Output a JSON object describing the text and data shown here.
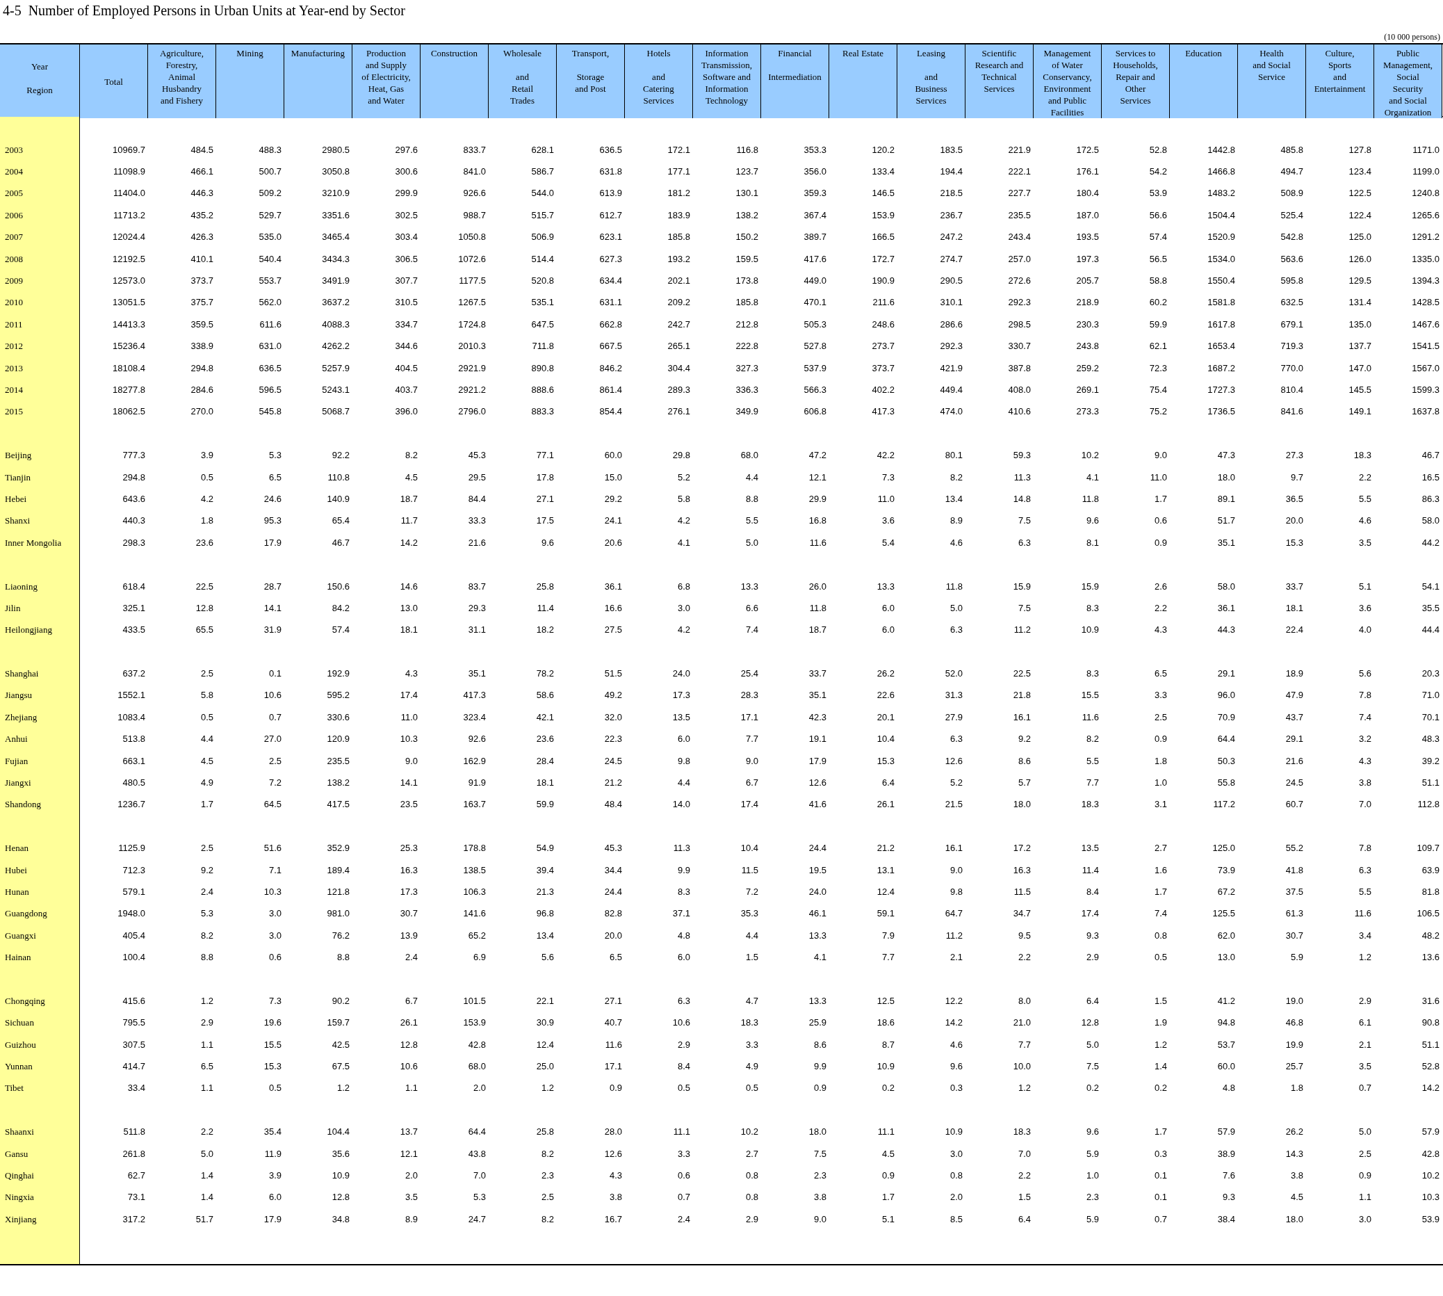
{
  "title": "4-5  Number of Employed Persons in Urban Units at Year-end by Sector",
  "unit": "(10 000 persons)",
  "table": {
    "corner": {
      "year_label": "Year",
      "region_label": "Region"
    },
    "columns": [
      "Total",
      "Agriculture,\nForestry,\nAnimal\nHusbandry\nand Fishery",
      "Mining",
      "Manufacturing",
      "Production\nand Supply\nof Electricity,\nHeat, Gas\nand Water",
      "Construction",
      "Wholesale\n\nand\nRetail\nTrades",
      "Transport,\n\nStorage\nand Post",
      "Hotels\n\nand\nCatering\nServices",
      "Information\nTransmission,\nSoftware and\nInformation\nTechnology",
      "Financial\n\nIntermediation",
      "Real Estate",
      "Leasing\n\nand\nBusiness\nServices",
      "Scientific\nResearch and\nTechnical\nServices",
      "Management\nof Water\nConservancy,\nEnvironment\nand Public\nFacilities",
      "Services to\nHouseholds,\nRepair and\nOther\nServices",
      "Education",
      "Health\nand Social\nService",
      "Culture,\nSports\nand\nEntertainment",
      "Public\nManagement,\nSocial\nSecurity\nand Social\nOrganization"
    ],
    "groups": [
      {
        "rows": [
          {
            "label": "2003",
            "values": [
              "10969.7",
              "484.5",
              "488.3",
              "2980.5",
              "297.6",
              "833.7",
              "628.1",
              "636.5",
              "172.1",
              "116.8",
              "353.3",
              "120.2",
              "183.5",
              "221.9",
              "172.5",
              "52.8",
              "1442.8",
              "485.8",
              "127.8",
              "1171.0"
            ]
          },
          {
            "label": "2004",
            "values": [
              "11098.9",
              "466.1",
              "500.7",
              "3050.8",
              "300.6",
              "841.0",
              "586.7",
              "631.8",
              "177.1",
              "123.7",
              "356.0",
              "133.4",
              "194.4",
              "222.1",
              "176.1",
              "54.2",
              "1466.8",
              "494.7",
              "123.4",
              "1199.0"
            ]
          },
          {
            "label": "2005",
            "values": [
              "11404.0",
              "446.3",
              "509.2",
              "3210.9",
              "299.9",
              "926.6",
              "544.0",
              "613.9",
              "181.2",
              "130.1",
              "359.3",
              "146.5",
              "218.5",
              "227.7",
              "180.4",
              "53.9",
              "1483.2",
              "508.9",
              "122.5",
              "1240.8"
            ]
          },
          {
            "label": "2006",
            "values": [
              "11713.2",
              "435.2",
              "529.7",
              "3351.6",
              "302.5",
              "988.7",
              "515.7",
              "612.7",
              "183.9",
              "138.2",
              "367.4",
              "153.9",
              "236.7",
              "235.5",
              "187.0",
              "56.6",
              "1504.4",
              "525.4",
              "122.4",
              "1265.6"
            ]
          },
          {
            "label": "2007",
            "values": [
              "12024.4",
              "426.3",
              "535.0",
              "3465.4",
              "303.4",
              "1050.8",
              "506.9",
              "623.1",
              "185.8",
              "150.2",
              "389.7",
              "166.5",
              "247.2",
              "243.4",
              "193.5",
              "57.4",
              "1520.9",
              "542.8",
              "125.0",
              "1291.2"
            ]
          },
          {
            "label": "2008",
            "values": [
              "12192.5",
              "410.1",
              "540.4",
              "3434.3",
              "306.5",
              "1072.6",
              "514.4",
              "627.3",
              "193.2",
              "159.5",
              "417.6",
              "172.7",
              "274.7",
              "257.0",
              "197.3",
              "56.5",
              "1534.0",
              "563.6",
              "126.0",
              "1335.0"
            ]
          },
          {
            "label": "2009",
            "values": [
              "12573.0",
              "373.7",
              "553.7",
              "3491.9",
              "307.7",
              "1177.5",
              "520.8",
              "634.4",
              "202.1",
              "173.8",
              "449.0",
              "190.9",
              "290.5",
              "272.6",
              "205.7",
              "58.8",
              "1550.4",
              "595.8",
              "129.5",
              "1394.3"
            ]
          },
          {
            "label": "2010",
            "values": [
              "13051.5",
              "375.7",
              "562.0",
              "3637.2",
              "310.5",
              "1267.5",
              "535.1",
              "631.1",
              "209.2",
              "185.8",
              "470.1",
              "211.6",
              "310.1",
              "292.3",
              "218.9",
              "60.2",
              "1581.8",
              "632.5",
              "131.4",
              "1428.5"
            ]
          },
          {
            "label": "2011",
            "values": [
              "14413.3",
              "359.5",
              "611.6",
              "4088.3",
              "334.7",
              "1724.8",
              "647.5",
              "662.8",
              "242.7",
              "212.8",
              "505.3",
              "248.6",
              "286.6",
              "298.5",
              "230.3",
              "59.9",
              "1617.8",
              "679.1",
              "135.0",
              "1467.6"
            ]
          },
          {
            "label": "2012",
            "values": [
              "15236.4",
              "338.9",
              "631.0",
              "4262.2",
              "344.6",
              "2010.3",
              "711.8",
              "667.5",
              "265.1",
              "222.8",
              "527.8",
              "273.7",
              "292.3",
              "330.7",
              "243.8",
              "62.1",
              "1653.4",
              "719.3",
              "137.7",
              "1541.5"
            ]
          },
          {
            "label": "2013",
            "values": [
              "18108.4",
              "294.8",
              "636.5",
              "5257.9",
              "404.5",
              "2921.9",
              "890.8",
              "846.2",
              "304.4",
              "327.3",
              "537.9",
              "373.7",
              "421.9",
              "387.8",
              "259.2",
              "72.3",
              "1687.2",
              "770.0",
              "147.0",
              "1567.0"
            ]
          },
          {
            "label": "2014",
            "values": [
              "18277.8",
              "284.6",
              "596.5",
              "5243.1",
              "403.7",
              "2921.2",
              "888.6",
              "861.4",
              "289.3",
              "336.3",
              "566.3",
              "402.2",
              "449.4",
              "408.0",
              "269.1",
              "75.4",
              "1727.3",
              "810.4",
              "145.5",
              "1599.3"
            ]
          },
          {
            "label": "2015",
            "values": [
              "18062.5",
              "270.0",
              "545.8",
              "5068.7",
              "396.0",
              "2796.0",
              "883.3",
              "854.4",
              "276.1",
              "349.9",
              "606.8",
              "417.3",
              "474.0",
              "410.6",
              "273.3",
              "75.2",
              "1736.5",
              "841.6",
              "149.1",
              "1637.8"
            ]
          }
        ]
      },
      {
        "rows": [
          {
            "label": "Beijing",
            "values": [
              "777.3",
              "3.9",
              "5.3",
              "92.2",
              "8.2",
              "45.3",
              "77.1",
              "60.0",
              "29.8",
              "68.0",
              "47.2",
              "42.2",
              "80.1",
              "59.3",
              "10.2",
              "9.0",
              "47.3",
              "27.3",
              "18.3",
              "46.7"
            ]
          },
          {
            "label": "Tianjin",
            "values": [
              "294.8",
              "0.5",
              "6.5",
              "110.8",
              "4.5",
              "29.5",
              "17.8",
              "15.0",
              "5.2",
              "4.4",
              "12.1",
              "7.3",
              "8.2",
              "11.3",
              "4.1",
              "11.0",
              "18.0",
              "9.7",
              "2.2",
              "16.5"
            ]
          },
          {
            "label": "Hebei",
            "values": [
              "643.6",
              "4.2",
              "24.6",
              "140.9",
              "18.7",
              "84.4",
              "27.1",
              "29.2",
              "5.8",
              "8.8",
              "29.9",
              "11.0",
              "13.4",
              "14.8",
              "11.8",
              "1.7",
              "89.1",
              "36.5",
              "5.5",
              "86.3"
            ]
          },
          {
            "label": "Shanxi",
            "values": [
              "440.3",
              "1.8",
              "95.3",
              "65.4",
              "11.7",
              "33.3",
              "17.5",
              "24.1",
              "4.2",
              "5.5",
              "16.8",
              "3.6",
              "8.9",
              "7.5",
              "9.6",
              "0.6",
              "51.7",
              "20.0",
              "4.6",
              "58.0"
            ]
          },
          {
            "label": "Inner Mongolia",
            "values": [
              "298.3",
              "23.6",
              "17.9",
              "46.7",
              "14.2",
              "21.6",
              "9.6",
              "20.6",
              "4.1",
              "5.0",
              "11.6",
              "5.4",
              "4.6",
              "6.3",
              "8.1",
              "0.9",
              "35.1",
              "15.3",
              "3.5",
              "44.2"
            ]
          }
        ]
      },
      {
        "rows": [
          {
            "label": "Liaoning",
            "values": [
              "618.4",
              "22.5",
              "28.7",
              "150.6",
              "14.6",
              "83.7",
              "25.8",
              "36.1",
              "6.8",
              "13.3",
              "26.0",
              "13.3",
              "11.8",
              "15.9",
              "15.9",
              "2.6",
              "58.0",
              "33.7",
              "5.1",
              "54.1"
            ]
          },
          {
            "label": "Jilin",
            "values": [
              "325.1",
              "12.8",
              "14.1",
              "84.2",
              "13.0",
              "29.3",
              "11.4",
              "16.6",
              "3.0",
              "6.6",
              "11.8",
              "6.0",
              "5.0",
              "7.5",
              "8.3",
              "2.2",
              "36.1",
              "18.1",
              "3.6",
              "35.5"
            ]
          },
          {
            "label": "Heilongjiang",
            "values": [
              "433.5",
              "65.5",
              "31.9",
              "57.4",
              "18.1",
              "31.1",
              "18.2",
              "27.5",
              "4.2",
              "7.4",
              "18.7",
              "6.0",
              "6.3",
              "11.2",
              "10.9",
              "4.3",
              "44.3",
              "22.4",
              "4.0",
              "44.4"
            ]
          }
        ]
      },
      {
        "rows": [
          {
            "label": "Shanghai",
            "values": [
              "637.2",
              "2.5",
              "0.1",
              "192.9",
              "4.3",
              "35.1",
              "78.2",
              "51.5",
              "24.0",
              "25.4",
              "33.7",
              "26.2",
              "52.0",
              "22.5",
              "8.3",
              "6.5",
              "29.1",
              "18.9",
              "5.6",
              "20.3"
            ]
          },
          {
            "label": "Jiangsu",
            "values": [
              "1552.1",
              "5.8",
              "10.6",
              "595.2",
              "17.4",
              "417.3",
              "58.6",
              "49.2",
              "17.3",
              "28.3",
              "35.1",
              "22.6",
              "31.3",
              "21.8",
              "15.5",
              "3.3",
              "96.0",
              "47.9",
              "7.8",
              "71.0"
            ]
          },
          {
            "label": "Zhejiang",
            "values": [
              "1083.4",
              "0.5",
              "0.7",
              "330.6",
              "11.0",
              "323.4",
              "42.1",
              "32.0",
              "13.5",
              "17.1",
              "42.3",
              "20.1",
              "27.9",
              "16.1",
              "11.6",
              "2.5",
              "70.9",
              "43.7",
              "7.4",
              "70.1"
            ]
          },
          {
            "label": "Anhui",
            "values": [
              "513.8",
              "4.4",
              "27.0",
              "120.9",
              "10.3",
              "92.6",
              "23.6",
              "22.3",
              "6.0",
              "7.7",
              "19.1",
              "10.4",
              "6.3",
              "9.2",
              "8.2",
              "0.9",
              "64.4",
              "29.1",
              "3.2",
              "48.3"
            ]
          },
          {
            "label": "Fujian",
            "values": [
              "663.1",
              "4.5",
              "2.5",
              "235.5",
              "9.0",
              "162.9",
              "28.4",
              "24.5",
              "9.8",
              "9.0",
              "17.9",
              "15.3",
              "12.6",
              "8.6",
              "5.5",
              "1.8",
              "50.3",
              "21.6",
              "4.3",
              "39.2"
            ]
          },
          {
            "label": "Jiangxi",
            "values": [
              "480.5",
              "4.9",
              "7.2",
              "138.2",
              "14.1",
              "91.9",
              "18.1",
              "21.2",
              "4.4",
              "6.7",
              "12.6",
              "6.4",
              "5.2",
              "5.7",
              "7.7",
              "1.0",
              "55.8",
              "24.5",
              "3.8",
              "51.1"
            ]
          },
          {
            "label": "Shandong",
            "values": [
              "1236.7",
              "1.7",
              "64.5",
              "417.5",
              "23.5",
              "163.7",
              "59.9",
              "48.4",
              "14.0",
              "17.4",
              "41.6",
              "26.1",
              "21.5",
              "18.0",
              "18.3",
              "3.1",
              "117.2",
              "60.7",
              "7.0",
              "112.8"
            ]
          }
        ]
      },
      {
        "rows": [
          {
            "label": "Henan",
            "values": [
              "1125.9",
              "2.5",
              "51.6",
              "352.9",
              "25.3",
              "178.8",
              "54.9",
              "45.3",
              "11.3",
              "10.4",
              "24.4",
              "21.2",
              "16.1",
              "17.2",
              "13.5",
              "2.7",
              "125.0",
              "55.2",
              "7.8",
              "109.7"
            ]
          },
          {
            "label": "Hubei",
            "values": [
              "712.3",
              "9.2",
              "7.1",
              "189.4",
              "16.3",
              "138.5",
              "39.4",
              "34.4",
              "9.9",
              "11.5",
              "19.5",
              "13.1",
              "9.0",
              "16.3",
              "11.4",
              "1.6",
              "73.9",
              "41.8",
              "6.3",
              "63.9"
            ]
          },
          {
            "label": "Hunan",
            "values": [
              "579.1",
              "2.4",
              "10.3",
              "121.8",
              "17.3",
              "106.3",
              "21.3",
              "24.4",
              "8.3",
              "7.2",
              "24.0",
              "12.4",
              "9.8",
              "11.5",
              "8.4",
              "1.7",
              "67.2",
              "37.5",
              "5.5",
              "81.8"
            ]
          },
          {
            "label": "Guangdong",
            "values": [
              "1948.0",
              "5.3",
              "3.0",
              "981.0",
              "30.7",
              "141.6",
              "96.8",
              "82.8",
              "37.1",
              "35.3",
              "46.1",
              "59.1",
              "64.7",
              "34.7",
              "17.4",
              "7.4",
              "125.5",
              "61.3",
              "11.6",
              "106.5"
            ]
          },
          {
            "label": "Guangxi",
            "values": [
              "405.4",
              "8.2",
              "3.0",
              "76.2",
              "13.9",
              "65.2",
              "13.4",
              "20.0",
              "4.8",
              "4.4",
              "13.3",
              "7.9",
              "11.2",
              "9.5",
              "9.3",
              "0.8",
              "62.0",
              "30.7",
              "3.4",
              "48.2"
            ]
          },
          {
            "label": "Hainan",
            "values": [
              "100.4",
              "8.8",
              "0.6",
              "8.8",
              "2.4",
              "6.9",
              "5.6",
              "6.5",
              "6.0",
              "1.5",
              "4.1",
              "7.7",
              "2.1",
              "2.2",
              "2.9",
              "0.5",
              "13.0",
              "5.9",
              "1.2",
              "13.6"
            ]
          }
        ]
      },
      {
        "rows": [
          {
            "label": "Chongqing",
            "values": [
              "415.6",
              "1.2",
              "7.3",
              "90.2",
              "6.7",
              "101.5",
              "22.1",
              "27.1",
              "6.3",
              "4.7",
              "13.3",
              "12.5",
              "12.2",
              "8.0",
              "6.4",
              "1.5",
              "41.2",
              "19.0",
              "2.9",
              "31.6"
            ]
          },
          {
            "label": "Sichuan",
            "values": [
              "795.5",
              "2.9",
              "19.6",
              "159.7",
              "26.1",
              "153.9",
              "30.9",
              "40.7",
              "10.6",
              "18.3",
              "25.9",
              "18.6",
              "14.2",
              "21.0",
              "12.8",
              "1.9",
              "94.8",
              "46.8",
              "6.1",
              "90.8"
            ]
          },
          {
            "label": "Guizhou",
            "values": [
              "307.5",
              "1.1",
              "15.5",
              "42.5",
              "12.8",
              "42.8",
              "12.4",
              "11.6",
              "2.9",
              "3.3",
              "8.6",
              "8.7",
              "4.6",
              "7.7",
              "5.0",
              "1.2",
              "53.7",
              "19.9",
              "2.1",
              "51.1"
            ]
          },
          {
            "label": "Yunnan",
            "values": [
              "414.7",
              "6.5",
              "15.3",
              "67.5",
              "10.6",
              "68.0",
              "25.0",
              "17.1",
              "8.4",
              "4.9",
              "9.9",
              "10.9",
              "9.6",
              "10.0",
              "7.5",
              "1.4",
              "60.0",
              "25.7",
              "3.5",
              "52.8"
            ]
          },
          {
            "label": "Tibet",
            "values": [
              "33.4",
              "1.1",
              "0.5",
              "1.2",
              "1.1",
              "2.0",
              "1.2",
              "0.9",
              "0.5",
              "0.5",
              "0.9",
              "0.2",
              "0.3",
              "1.2",
              "0.2",
              "0.2",
              "4.8",
              "1.8",
              "0.7",
              "14.2"
            ]
          }
        ]
      },
      {
        "rows": [
          {
            "label": "Shaanxi",
            "values": [
              "511.8",
              "2.2",
              "35.4",
              "104.4",
              "13.7",
              "64.4",
              "25.8",
              "28.0",
              "11.1",
              "10.2",
              "18.0",
              "11.1",
              "10.9",
              "18.3",
              "9.6",
              "1.7",
              "57.9",
              "26.2",
              "5.0",
              "57.9"
            ]
          },
          {
            "label": "Gansu",
            "values": [
              "261.8",
              "5.0",
              "11.9",
              "35.6",
              "12.1",
              "43.8",
              "8.2",
              "12.6",
              "3.3",
              "2.7",
              "7.5",
              "4.5",
              "3.0",
              "7.0",
              "5.9",
              "0.3",
              "38.9",
              "14.3",
              "2.5",
              "42.8"
            ]
          },
          {
            "label": "Qinghai",
            "values": [
              "62.7",
              "1.4",
              "3.9",
              "10.9",
              "2.0",
              "7.0",
              "2.3",
              "4.3",
              "0.6",
              "0.8",
              "2.3",
              "0.9",
              "0.8",
              "2.2",
              "1.0",
              "0.1",
              "7.6",
              "3.8",
              "0.9",
              "10.2"
            ]
          },
          {
            "label": "Ningxia",
            "values": [
              "73.1",
              "1.4",
              "6.0",
              "12.8",
              "3.5",
              "5.3",
              "2.5",
              "3.8",
              "0.7",
              "0.8",
              "3.8",
              "1.7",
              "2.0",
              "1.5",
              "2.3",
              "0.1",
              "9.3",
              "4.5",
              "1.1",
              "10.3"
            ]
          },
          {
            "label": "Xinjiang",
            "values": [
              "317.2",
              "51.7",
              "17.9",
              "34.8",
              "8.9",
              "24.7",
              "8.2",
              "16.7",
              "2.4",
              "2.9",
              "9.0",
              "5.1",
              "8.5",
              "6.4",
              "5.9",
              "0.7",
              "38.4",
              "18.0",
              "3.0",
              "53.9"
            ]
          }
        ]
      }
    ]
  }
}
